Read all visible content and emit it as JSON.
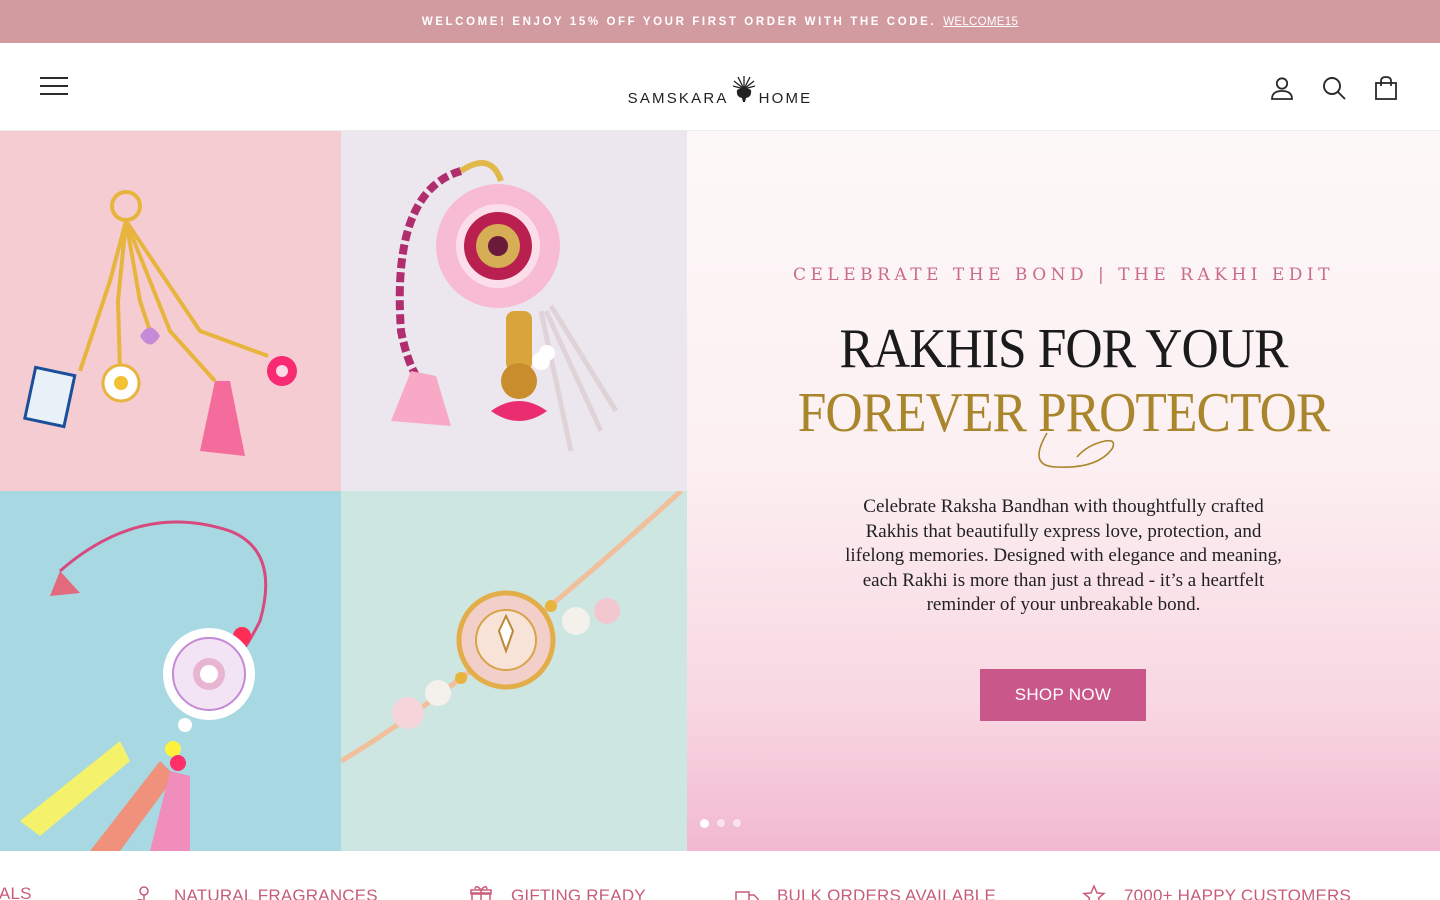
{
  "announcement": {
    "text": "WELCOME! ENJOY 15% OFF YOUR FIRST ORDER WITH THE CODE.",
    "code_link": "WELCOME15"
  },
  "header": {
    "logo_left": "SAMSKARA",
    "logo_right": "HOME",
    "icons": [
      "menu-icon",
      "account-icon",
      "search-icon",
      "cart-icon"
    ]
  },
  "hero": {
    "eyebrow": "CELEBRATE THE BOND | THE RAKHI EDIT",
    "headline_line1": "RAKHIS FOR YOUR",
    "headline_line2": "FOREVER PROTECTOR",
    "description": "Celebrate Raksha Bandhan with thoughtfully crafted Rakhis that beautifully express love, protection, and lifelong memories. Designed with elegance and meaning, each Rakhi is more than just a thread - it’s a heartfelt reminder of your unbreakable bond.",
    "cta": "SHOP NOW",
    "slides_total": 3,
    "slide_active": 1,
    "colors": {
      "accent": "#c9578a",
      "gold": "#a9862b",
      "eyebrow": "#c96c8b",
      "announce_bg": "#d29ba0"
    }
  },
  "features": [
    {
      "label": "IALS",
      "icon": ""
    },
    {
      "label": "NATURAL FRAGRANCES",
      "icon": "flower-icon"
    },
    {
      "label": "GIFTING READY",
      "icon": "gift-icon"
    },
    {
      "label": "BULK ORDERS AVAILABLE",
      "icon": "truck-icon"
    },
    {
      "label": "7000+ HAPPY CUSTOMERS",
      "icon": "star-icon"
    }
  ]
}
